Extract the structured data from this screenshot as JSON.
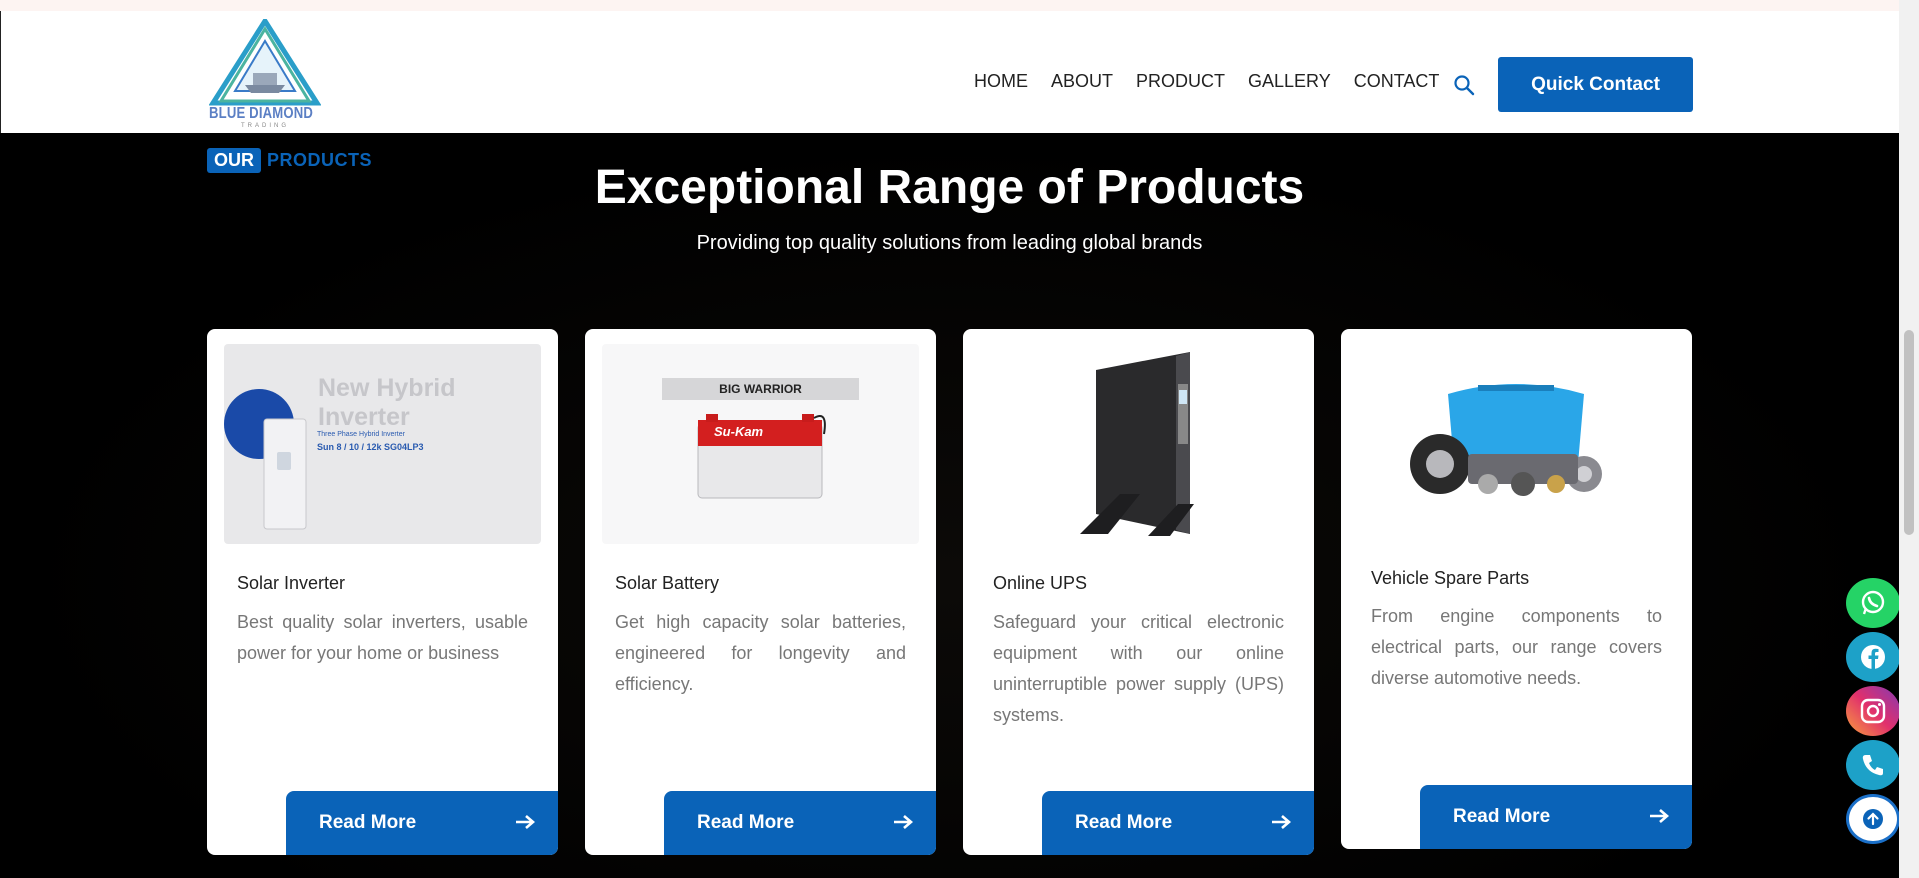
{
  "header": {
    "logo_text": "BLUE DIAMOND",
    "logo_subtext": "TRADING",
    "nav": [
      "HOME",
      "ABOUT",
      "PRODUCT",
      "GALLERY",
      "CONTACT"
    ],
    "cta_label": "Quick Contact"
  },
  "section": {
    "eyebrow_tag": "OUR",
    "eyebrow_text": "PRODUCTS",
    "heading": "Exceptional Range of Products",
    "subheading": "Providing top quality solutions from leading global brands"
  },
  "cards": [
    {
      "title": "Solar Inverter",
      "description": "Best quality solar inverters, usable power for your home or business",
      "button": "Read More",
      "image": {
        "headline": "New Hybrid Inverter",
        "subtitle": "Three Phase Hybrid Inverter",
        "model": "Sun 8 / 10 / 12k SG04LP3"
      }
    },
    {
      "title": "Solar Battery",
      "description": "Get high capacity solar batteries, engineered for longevity and efficiency.",
      "button": "Read More",
      "image": {
        "headline": "BIG WARRIOR",
        "brand": "Su-Kam"
      }
    },
    {
      "title": "Online UPS",
      "description": "Safeguard your critical electronic equipment with our online uninterruptible power supply (UPS) systems.",
      "button": "Read More"
    },
    {
      "title": "Vehicle Spare Parts",
      "description": "From engine components to electrical parts, our range covers diverse automotive needs.",
      "button": "Read More"
    }
  ],
  "floating_icons": [
    "whatsapp-icon",
    "facebook-icon",
    "instagram-icon",
    "phone-icon",
    "scroll-top-icon"
  ],
  "colors": {
    "brand_blue": "#0a63b8",
    "whatsapp": "#25d366",
    "facebook": "#1da1c8",
    "phone": "#1da1c8"
  }
}
